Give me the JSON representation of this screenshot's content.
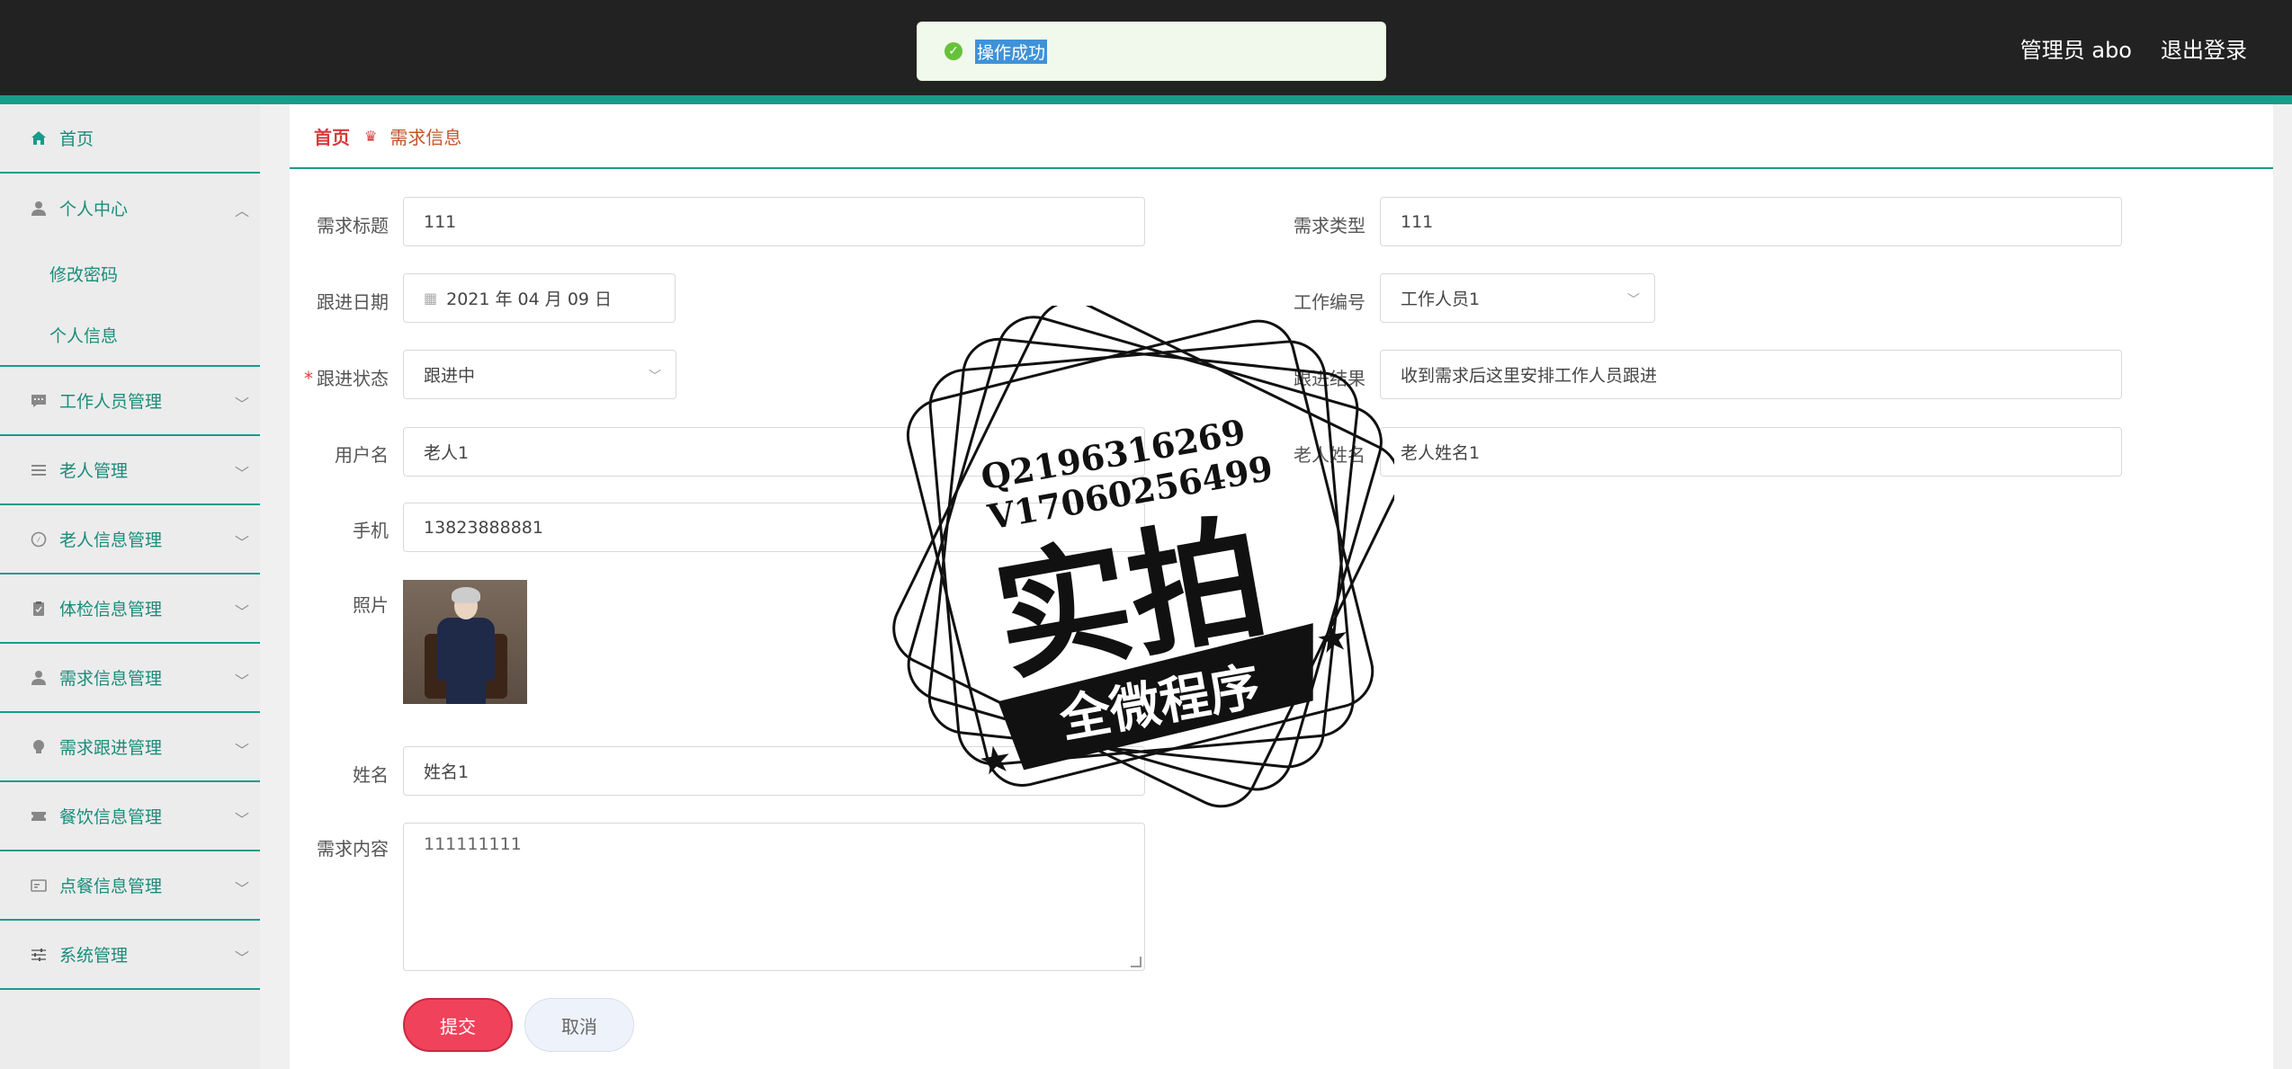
{
  "header": {
    "admin_label": "管理员 abo",
    "logout_label": "退出登录"
  },
  "toast": {
    "message": "操作成功"
  },
  "sidebar": {
    "items": [
      {
        "label": "首页",
        "icon": "home-icon"
      },
      {
        "label": "个人中心",
        "icon": "user-icon",
        "expanded": true,
        "children": [
          {
            "label": "修改密码"
          },
          {
            "label": "个人信息"
          }
        ]
      },
      {
        "label": "工作人员管理",
        "icon": "chat-icon"
      },
      {
        "label": "老人管理",
        "icon": "list-icon"
      },
      {
        "label": "老人信息管理",
        "icon": "compass-icon"
      },
      {
        "label": "体检信息管理",
        "icon": "clipboard-icon"
      },
      {
        "label": "需求信息管理",
        "icon": "user-icon"
      },
      {
        "label": "需求跟进管理",
        "icon": "bulb-icon"
      },
      {
        "label": "餐饮信息管理",
        "icon": "ticket-icon"
      },
      {
        "label": "点餐信息管理",
        "icon": "card-icon"
      },
      {
        "label": "系统管理",
        "icon": "settings-icon"
      }
    ]
  },
  "breadcrumb": {
    "home": "首页",
    "current": "需求信息"
  },
  "form": {
    "title": {
      "label": "需求标题",
      "value": "111"
    },
    "type": {
      "label": "需求类型",
      "value": "111"
    },
    "date": {
      "label": "跟进日期",
      "value": "2021 年 04 月 09 日"
    },
    "worker_no": {
      "label": "工作编号",
      "value": "工作人员1"
    },
    "status": {
      "label": "跟进状态",
      "value": "跟进中"
    },
    "result": {
      "label": "跟进结果",
      "value": "收到需求后这里安排工作人员跟进"
    },
    "username": {
      "label": "用户名",
      "value": "老人1"
    },
    "elder_name": {
      "label": "老人姓名",
      "value": "老人姓名1"
    },
    "phone": {
      "label": "手机",
      "value": "13823888881"
    },
    "photo": {
      "label": "照片"
    },
    "name": {
      "label": "姓名",
      "value": "姓名1"
    },
    "content": {
      "label": "需求内容",
      "value": "111111111"
    },
    "submit_label": "提交",
    "cancel_label": "取消"
  },
  "watermark": {
    "line1": "Q2196316269",
    "line2": "V17060256499",
    "big": "实拍",
    "banner": "全微程序"
  },
  "colors": {
    "accent": "#189c8a",
    "topbar": "#222222",
    "submit": "#f1425b",
    "breadcrumb_home": "#d63a3a"
  }
}
